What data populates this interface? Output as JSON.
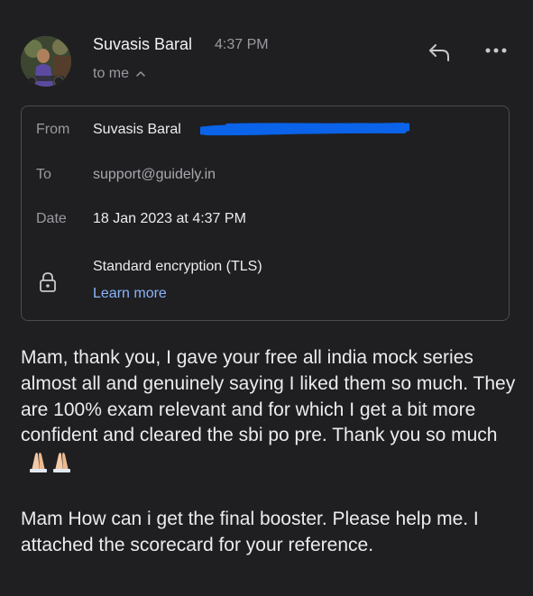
{
  "header": {
    "sender_name": "Suvasis Baral",
    "time": "4:37 PM",
    "recipient_summary": "to me"
  },
  "icons": {
    "avatar": "avatar",
    "reply": "reply-icon",
    "more": "more-icon",
    "collapse": "chevron-up-icon",
    "lock": "lock-icon"
  },
  "details": {
    "from_label": "From",
    "from_name": "Suvasis Baral",
    "to_label": "To",
    "to_value": "support@guidely.in",
    "date_label": "Date",
    "date_value": "18 Jan 2023 at 4:37 PM",
    "encryption": "Standard encryption (TLS)",
    "learn_more": "Learn more"
  },
  "body": {
    "paragraph1": "Mam, thank you, I gave your free all india mock series almost all and genuinely saying I liked them so much. They are 100% exam relevant and for which I get a bit more confident and cleared the sbi po pre. Thank you so much",
    "paragraph2": "Mam How can i get the final booster. Please help me. I attached the scorecard for your reference."
  },
  "colors": {
    "background": "#1f1f22",
    "link": "#8ab4f8",
    "redaction": "#0a63e8"
  }
}
